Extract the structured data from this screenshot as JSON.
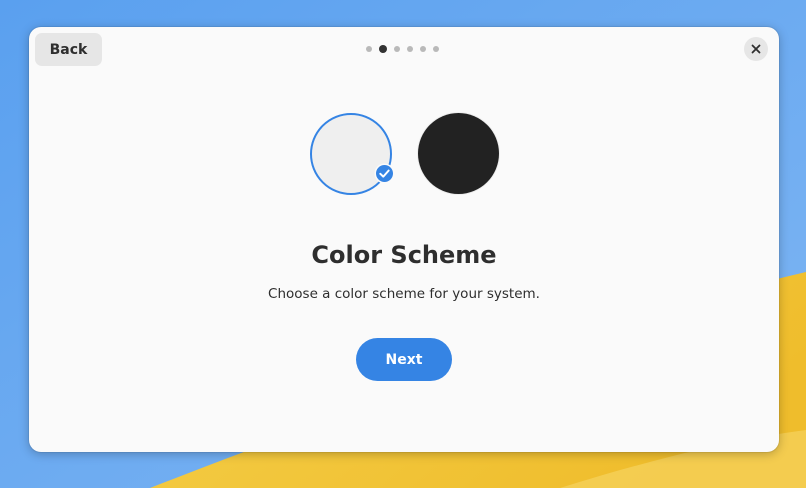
{
  "dialog": {
    "back_label": "Back",
    "page_count": 6,
    "active_page": 2,
    "title": "Color Scheme",
    "subtitle": "Choose a color scheme for your system.",
    "next_label": "Next"
  },
  "schemes": [
    {
      "name": "light",
      "selected": true,
      "color": "#efefef"
    },
    {
      "name": "dark",
      "selected": false,
      "color": "#222222"
    }
  ],
  "colors": {
    "accent": "#3584e4",
    "wallpaper_blue": "#5fa3f0",
    "wallpaper_yellow": "#f2c232"
  },
  "icons": {
    "close": "close-icon",
    "check": "checkmark-icon"
  }
}
